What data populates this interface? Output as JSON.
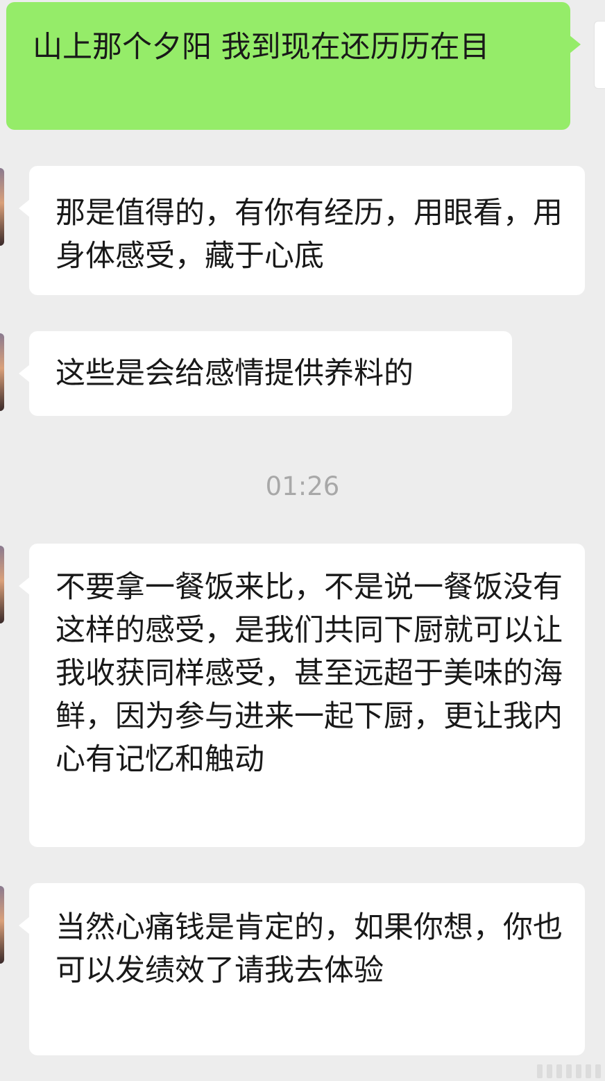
{
  "messages": [
    {
      "side": "sent",
      "text": "山上那个夕阳 我到现在还历历在目"
    },
    {
      "side": "received",
      "text": "那是值得的，有你有经历，用眼看，用身体感受，藏于心底"
    },
    {
      "side": "received",
      "text": "这些是会给感情提供养料的"
    },
    {
      "side": "received",
      "text": "不要拿一餐饭来比，不是说一餐饭没有这样的感受，是我们共同下厨就可以让我收获同样感受，甚至远超于美味的海鲜，因为参与进来一起下厨，更让我内心有记忆和触动"
    },
    {
      "side": "received",
      "text": "当然心痛钱是肯定的，如果你想，你也可以发绩效了请我去体验"
    }
  ],
  "timestamp": "01:26",
  "colors": {
    "background": "#ededed",
    "sent_bubble": "#95ec69",
    "received_bubble": "#ffffff",
    "timestamp_text": "#a8a8a8",
    "message_text": "#191919"
  }
}
